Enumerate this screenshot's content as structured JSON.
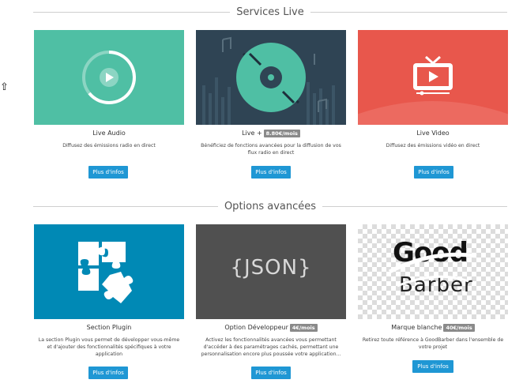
{
  "sections": [
    {
      "title": "Services Live",
      "cards": [
        {
          "title": "Live Audio",
          "price": "",
          "desc": "Diffusez des émissions radio en direct",
          "button": "Plus d'infos"
        },
        {
          "title": "Live +",
          "price": "8.80€/mois",
          "desc": "Bénéficiez de fonctions avancées pour la diffusion de vos flux radio en direct",
          "button": "Plus d'infos"
        },
        {
          "title": "Live Video",
          "price": "",
          "desc": "Diffusez des émissions vidéo en direct",
          "button": "Plus d'infos"
        }
      ]
    },
    {
      "title": "Options avancées",
      "cards": [
        {
          "title": "Section Plugin",
          "price": "",
          "desc": "La section Plugin vous permet de développer vous-même et d'ajouter des fonctionnalités spécifiques à votre application",
          "button": "Plus d'infos"
        },
        {
          "title": "Option Développeur",
          "price": "4€/mois",
          "desc": "Activez les fonctionnalités avancées vous permettant d'accéder à des paramétrages cachés, permettant une personnalisation encore plus poussée votre application...",
          "button": "Plus d'infos",
          "thumb_text": "{JSON}"
        },
        {
          "title": "Marque blanche",
          "price": "40€/mois",
          "desc": "Retirez toute référence à GoodBarber dans l'ensemble de votre projet",
          "button": "Plus d'infos",
          "thumb_text_1": "Good",
          "thumb_text_2": "Barber"
        }
      ]
    }
  ],
  "side_arrow": "⇧",
  "colors": {
    "teal": "#4fbfa4",
    "navy": "#2f4454",
    "red": "#e8574c",
    "blue": "#0089b5",
    "darkgray": "#505050",
    "button": "#1f97d4",
    "price_badge": "#8a8a8a"
  },
  "icons": {
    "card_0_0": "disc-play-icon",
    "card_0_1": "vinyl-record-icon",
    "card_0_2": "tv-play-icon",
    "card_1_0": "puzzle-icon",
    "card_1_1": "json-text",
    "card_1_2": "goodbarber-logo"
  }
}
